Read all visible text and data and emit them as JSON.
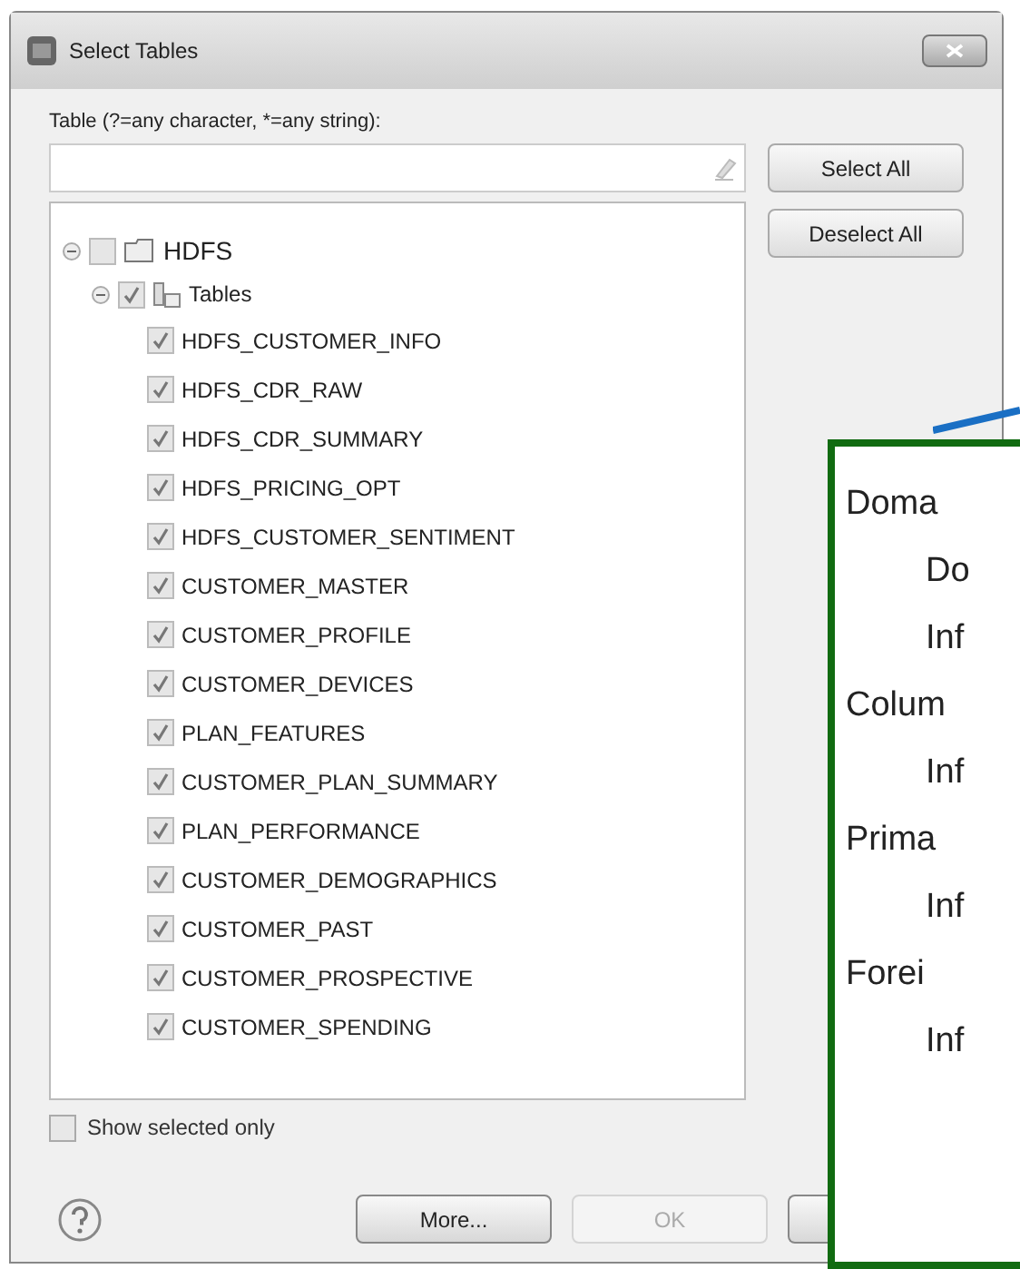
{
  "window": {
    "title": "Select Tables"
  },
  "filter": {
    "label": "Table (?=any character, *=any string):"
  },
  "side_buttons": [
    "Select All",
    "Deselect All"
  ],
  "tree": [
    {
      "label": "HDFS",
      "kind": "folder",
      "checked": false,
      "expanded": true,
      "children": [
        {
          "label": "Tables",
          "kind": "group",
          "checked": true,
          "expanded": true,
          "children": [
            {
              "label": "HDFS_CUSTOMER_INFO",
              "kind": "table",
              "checked": true
            },
            {
              "label": "HDFS_CDR_RAW",
              "kind": "table",
              "checked": true
            },
            {
              "label": "HDFS_CDR_SUMMARY",
              "kind": "table",
              "checked": true
            },
            {
              "label": "HDFS_PRICING_OPT",
              "kind": "table",
              "checked": true
            },
            {
              "label": "HDFS_CUSTOMER_SENTIMENT",
              "kind": "table",
              "checked": true
            },
            {
              "label": "CUSTOMER_MASTER",
              "kind": "table",
              "checked": true
            },
            {
              "label": "CUSTOMER_PROFILE",
              "kind": "table",
              "checked": true
            },
            {
              "label": "CUSTOMER_DEVICES",
              "kind": "table",
              "checked": true
            },
            {
              "label": "PLAN_FEATURES",
              "kind": "table",
              "checked": true
            },
            {
              "label": "CUSTOMER_PLAN_SUMMARY",
              "kind": "table",
              "checked": true
            },
            {
              "label": "PLAN_PERFORMANCE",
              "kind": "table",
              "checked": true
            },
            {
              "label": "CUSTOMER_DEMOGRAPHICS",
              "kind": "table",
              "checked": true
            },
            {
              "label": "CUSTOMER_PAST",
              "kind": "table",
              "checked": true
            },
            {
              "label": "CUSTOMER_PROSPECTIVE",
              "kind": "table",
              "checked": true
            },
            {
              "label": "CUSTOMER_SPENDING",
              "kind": "table",
              "checked": true
            }
          ]
        }
      ]
    }
  ],
  "show_selected_only": {
    "label": "Show selected only",
    "checked": false
  },
  "bottom_buttons": [
    {
      "label": "More...",
      "disabled": false
    },
    {
      "label": "OK",
      "disabled": true
    },
    {
      "disabled": false,
      "partly_hidden": true
    }
  ],
  "callout": {
    "items": [
      {
        "label": "Doma",
        "kind": "header"
      },
      {
        "label": "Do",
        "kind": "sub"
      },
      {
        "label": "Inf",
        "kind": "sub"
      },
      {
        "label": "Colum",
        "kind": "header"
      },
      {
        "label": "Inf",
        "kind": "sub"
      },
      {
        "label": "Prima",
        "kind": "header"
      },
      {
        "label": "Inf",
        "kind": "sub"
      },
      {
        "label": "Forei",
        "kind": "header"
      },
      {
        "label": "Inf",
        "kind": "sub"
      }
    ]
  }
}
